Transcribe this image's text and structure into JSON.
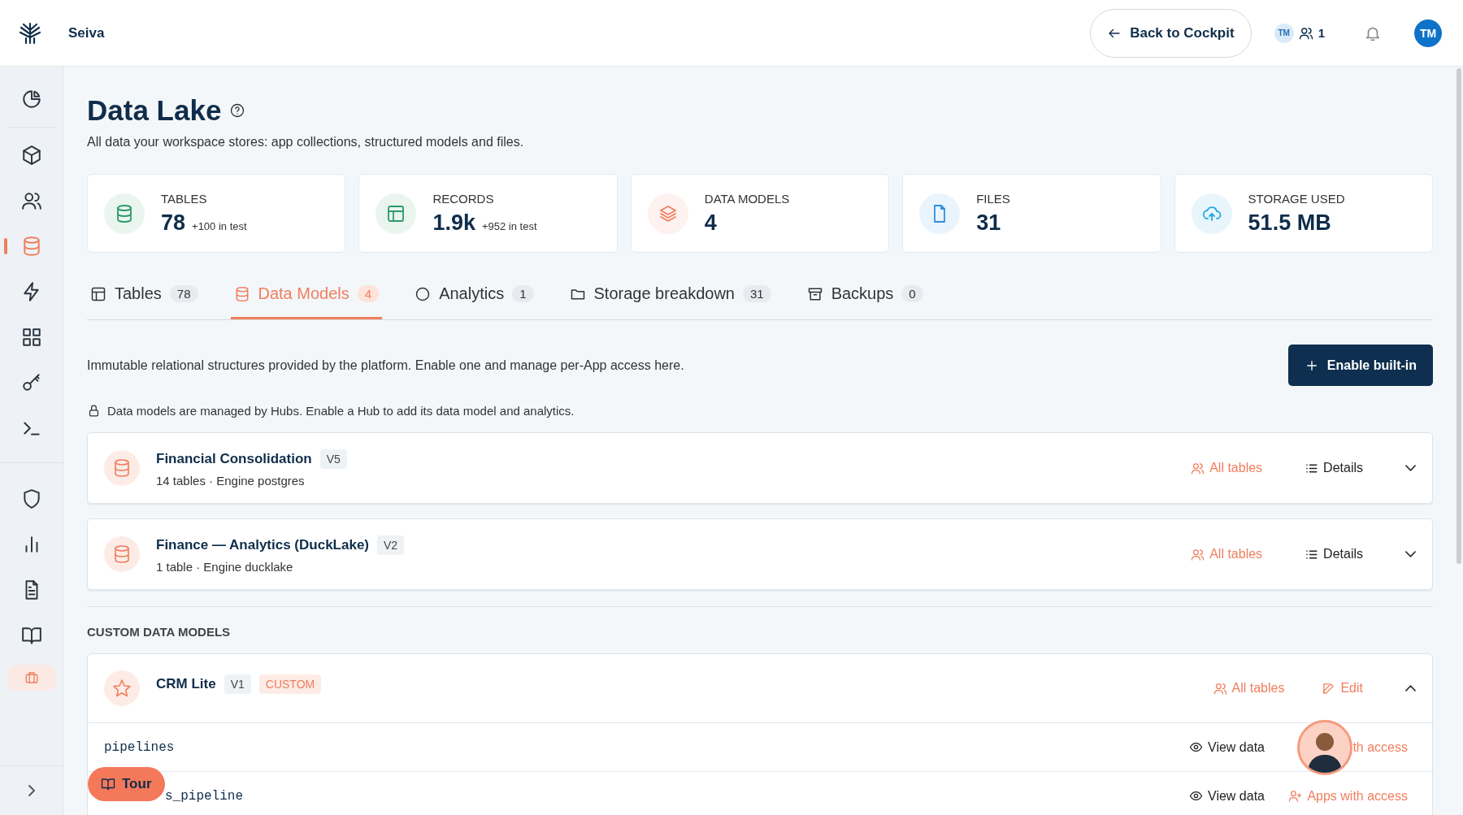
{
  "brand": {
    "name": "Seiva"
  },
  "header": {
    "back_button": "Back to Cockpit",
    "presence_initials": "TM",
    "presence_count": "1",
    "user_initials": "TM"
  },
  "sidebar": {
    "items": [
      {
        "selected": false,
        "highlighted": false
      },
      {
        "selected": false,
        "highlighted": false
      },
      {
        "selected": false,
        "highlighted": false
      },
      {
        "selected": true,
        "highlighted": false
      },
      {
        "selected": false,
        "highlighted": false
      },
      {
        "selected": false,
        "highlighted": false
      },
      {
        "selected": false,
        "highlighted": false
      },
      {
        "selected": false,
        "highlighted": false
      },
      {
        "selected": false,
        "highlighted": false
      },
      {
        "selected": false,
        "highlighted": false
      },
      {
        "selected": false,
        "highlighted": false
      },
      {
        "selected": false,
        "highlighted": false
      },
      {
        "selected": false,
        "highlighted": true
      }
    ]
  },
  "page": {
    "title": "Data Lake",
    "subtitle": "All data your workspace stores: app collections, structured models and files."
  },
  "stats": [
    {
      "label": "TABLES",
      "value": "78",
      "note": "+100 in test",
      "color": "#2e9a6a"
    },
    {
      "label": "RECORDS",
      "value": "1.9k",
      "note": "+952 in test",
      "color": "#2e9a6a"
    },
    {
      "label": "DATA MODELS",
      "value": "4",
      "color": "#f07e5e"
    },
    {
      "label": "FILES",
      "value": "31",
      "color": "#2f8fe0"
    },
    {
      "label": "STORAGE USED",
      "value": "51.5 MB",
      "color": "#20a9e0"
    }
  ],
  "tabs": [
    {
      "label": "Tables",
      "count": "78",
      "selected": false
    },
    {
      "label": "Data Models",
      "count": "4",
      "selected": true
    },
    {
      "label": "Analytics",
      "count": "1",
      "selected": false
    },
    {
      "label": "Storage breakdown",
      "count": "31",
      "selected": false
    },
    {
      "label": "Backups",
      "count": "0",
      "selected": false
    }
  ],
  "intro": "Immutable relational structures provided by the platform. Enable one and manage per-App access here.",
  "enable_button": "Enable built-in",
  "notice": "Data models are managed by Hubs. Enable a Hub to add its data model and analytics.",
  "builtin_models": [
    {
      "name": "Financial Consolidation",
      "version": "V5",
      "meta": "14 tables · Engine postgres",
      "access": "All tables",
      "details": "Details",
      "expanded": false
    },
    {
      "name": "Finance — Analytics (DuckLake)",
      "version": "V2",
      "meta": "1 table · Engine ducklake",
      "access": "All tables",
      "details": "Details",
      "expanded": false
    }
  ],
  "custom_section": {
    "title": "CUSTOM DATA MODELS",
    "models": [
      {
        "name": "CRM Lite",
        "version": "V1",
        "tag": "CUSTOM",
        "access": "All tables",
        "edit": "Edit",
        "expanded": true,
        "tables": [
          {
            "name": "pipelines",
            "view": "View data",
            "access": "th access",
            "partial": false,
            "icon": false
          },
          {
            "name": "s_pipeline",
            "view": "View data",
            "access": "Apps with access",
            "partial": true,
            "icon": true
          }
        ]
      }
    ]
  },
  "tour_button": "Tour"
}
